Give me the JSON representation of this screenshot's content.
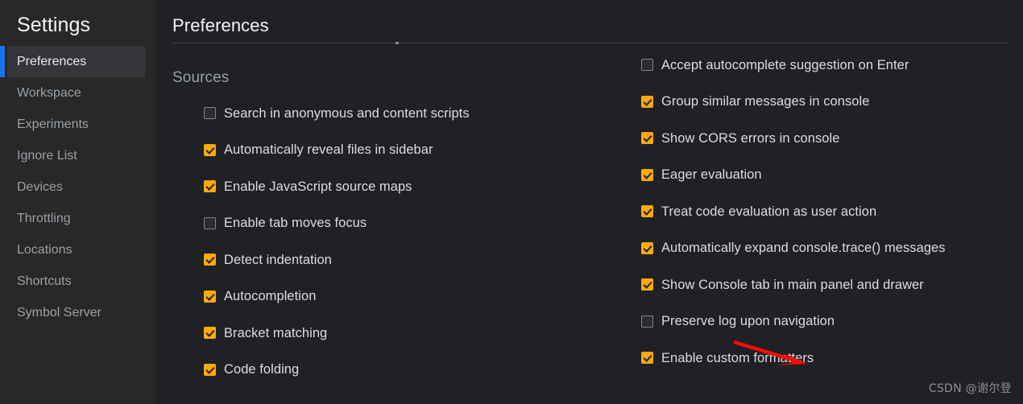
{
  "sidebar": {
    "title": "Settings",
    "items": [
      {
        "label": "Preferences",
        "selected": true
      },
      {
        "label": "Workspace",
        "selected": false
      },
      {
        "label": "Experiments",
        "selected": false
      },
      {
        "label": "Ignore List",
        "selected": false
      },
      {
        "label": "Devices",
        "selected": false
      },
      {
        "label": "Throttling",
        "selected": false
      },
      {
        "label": "Locations",
        "selected": false
      },
      {
        "label": "Shortcuts",
        "selected": false
      },
      {
        "label": "Symbol Server",
        "selected": false
      }
    ]
  },
  "header": {
    "title": "Preferences"
  },
  "left_column": {
    "section_heading": "Sources",
    "options": [
      {
        "label": "Search in anonymous and content scripts",
        "checked": false
      },
      {
        "label": "Automatically reveal files in sidebar",
        "checked": true
      },
      {
        "label": "Enable JavaScript source maps",
        "checked": true
      },
      {
        "label": "Enable tab moves focus",
        "checked": false
      },
      {
        "label": "Detect indentation",
        "checked": true
      },
      {
        "label": "Autocompletion",
        "checked": true
      },
      {
        "label": "Bracket matching",
        "checked": true
      },
      {
        "label": "Code folding",
        "checked": true
      }
    ]
  },
  "right_column": {
    "options": [
      {
        "label": "Accept autocomplete suggestion on Enter",
        "checked": false
      },
      {
        "label": "Group similar messages in console",
        "checked": true
      },
      {
        "label": "Show CORS errors in console",
        "checked": true
      },
      {
        "label": "Eager evaluation",
        "checked": true
      },
      {
        "label": "Treat code evaluation as user action",
        "checked": true
      },
      {
        "label": "Automatically expand console.trace() messages",
        "checked": true
      },
      {
        "label": "Show Console tab in main panel and drawer",
        "checked": true
      },
      {
        "label": "Preserve log upon navigation",
        "checked": false
      },
      {
        "label": "Enable custom formatters",
        "checked": true
      }
    ]
  },
  "annotation": {
    "arrow_color": "#fb0b05",
    "points_to": "Enable custom formatters"
  },
  "watermark": {
    "text": "CSDN @谢尔登"
  },
  "colors": {
    "background": "#202124",
    "sidebar_background": "#282828",
    "selected_accent": "#1a73e8",
    "selected_background": "#35363a",
    "checkbox_checked": "#fba90d",
    "text_primary": "#e8eaed",
    "text_secondary": "#9aa0a6"
  }
}
